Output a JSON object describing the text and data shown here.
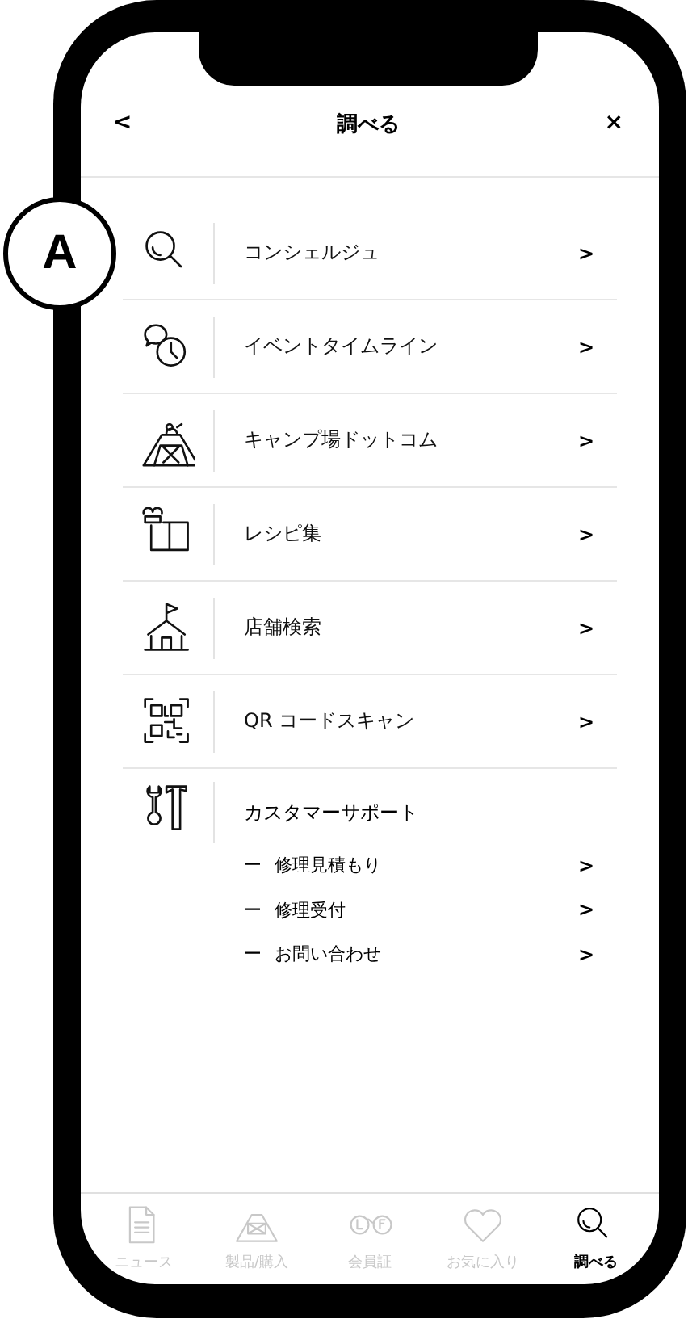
{
  "header": {
    "back": "<",
    "title": "調べる",
    "close": "×"
  },
  "callout": {
    "label": "A"
  },
  "menu": [
    {
      "kind": "search",
      "label": "コンシェルジュ",
      "chevron": ">"
    },
    {
      "kind": "timeline",
      "label": "イベントタイムライン",
      "chevron": ">"
    },
    {
      "kind": "camp",
      "label": "キャンプ場ドットコム",
      "chevron": ">"
    },
    {
      "kind": "recipe",
      "label": "レシピ集",
      "chevron": ">"
    },
    {
      "kind": "store",
      "label": "店舗検索",
      "chevron": ">"
    },
    {
      "kind": "qr",
      "label": "QR コードスキャン",
      "chevron": ">"
    },
    {
      "kind": "tools",
      "label": "カスタマーサポート",
      "children": [
        {
          "marker": "ー",
          "label": "修理見積もり",
          "chevron": ">"
        },
        {
          "marker": "ー",
          "label": "修理受付",
          "chevron": ">"
        },
        {
          "marker": "ー",
          "label": "お問い合わせ",
          "chevron": ">"
        }
      ]
    }
  ],
  "tabs": [
    {
      "kind": "news",
      "label": "ニュース",
      "selected": false
    },
    {
      "kind": "tent",
      "label": "製品/購入",
      "selected": false
    },
    {
      "kind": "member",
      "label": "会員証",
      "selected": false
    },
    {
      "kind": "heart",
      "label": "お気に入り",
      "selected": false
    },
    {
      "kind": "search",
      "label": "調べる",
      "selected": true
    }
  ]
}
